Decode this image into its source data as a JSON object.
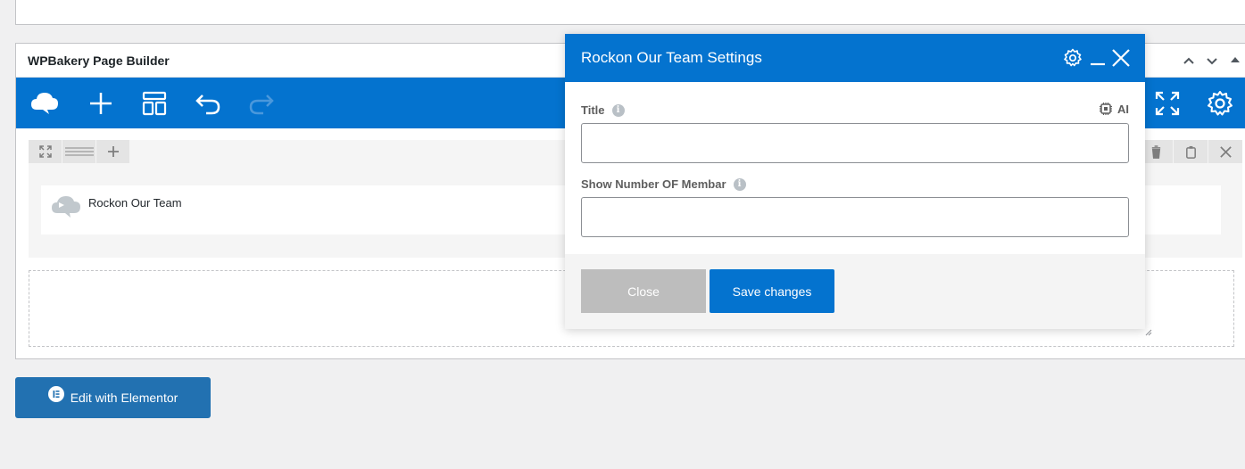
{
  "builder": {
    "title": "WPBakery Page Builder",
    "toolbar": {
      "icons": [
        "logo-cloud-icon",
        "plus-icon",
        "layout-template-icon",
        "undo-icon",
        "redo-icon",
        "fullscreen-icon",
        "settings-gear-icon"
      ]
    },
    "row": {
      "element_label": "Rockon Our Team"
    }
  },
  "modal": {
    "title": "Rockon Our Team Settings",
    "fields": [
      {
        "label": "Title",
        "value": "",
        "placeholder": ""
      },
      {
        "label": "Show Number OF Membar",
        "value": "",
        "placeholder": ""
      }
    ],
    "ai_label": "AI",
    "close_label": "Close",
    "save_label": "Save changes"
  },
  "elementor": {
    "button_label": "Edit with Elementor"
  },
  "colors": {
    "accent": "#0473cf",
    "elementor": "#2271b1",
    "close_button": "#bdbdbd"
  }
}
